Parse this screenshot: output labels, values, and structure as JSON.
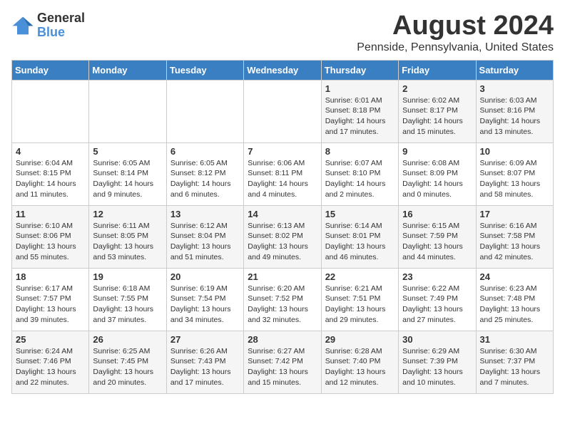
{
  "logo": {
    "general": "General",
    "blue": "Blue"
  },
  "title": "August 2024",
  "location": "Pennside, Pennsylvania, United States",
  "days_of_week": [
    "Sunday",
    "Monday",
    "Tuesday",
    "Wednesday",
    "Thursday",
    "Friday",
    "Saturday"
  ],
  "weeks": [
    [
      {
        "day": "",
        "info": ""
      },
      {
        "day": "",
        "info": ""
      },
      {
        "day": "",
        "info": ""
      },
      {
        "day": "",
        "info": ""
      },
      {
        "day": "1",
        "info": "Sunrise: 6:01 AM\nSunset: 8:18 PM\nDaylight: 14 hours\nand 17 minutes."
      },
      {
        "day": "2",
        "info": "Sunrise: 6:02 AM\nSunset: 8:17 PM\nDaylight: 14 hours\nand 15 minutes."
      },
      {
        "day": "3",
        "info": "Sunrise: 6:03 AM\nSunset: 8:16 PM\nDaylight: 14 hours\nand 13 minutes."
      }
    ],
    [
      {
        "day": "4",
        "info": "Sunrise: 6:04 AM\nSunset: 8:15 PM\nDaylight: 14 hours\nand 11 minutes."
      },
      {
        "day": "5",
        "info": "Sunrise: 6:05 AM\nSunset: 8:14 PM\nDaylight: 14 hours\nand 9 minutes."
      },
      {
        "day": "6",
        "info": "Sunrise: 6:05 AM\nSunset: 8:12 PM\nDaylight: 14 hours\nand 6 minutes."
      },
      {
        "day": "7",
        "info": "Sunrise: 6:06 AM\nSunset: 8:11 PM\nDaylight: 14 hours\nand 4 minutes."
      },
      {
        "day": "8",
        "info": "Sunrise: 6:07 AM\nSunset: 8:10 PM\nDaylight: 14 hours\nand 2 minutes."
      },
      {
        "day": "9",
        "info": "Sunrise: 6:08 AM\nSunset: 8:09 PM\nDaylight: 14 hours\nand 0 minutes."
      },
      {
        "day": "10",
        "info": "Sunrise: 6:09 AM\nSunset: 8:07 PM\nDaylight: 13 hours\nand 58 minutes."
      }
    ],
    [
      {
        "day": "11",
        "info": "Sunrise: 6:10 AM\nSunset: 8:06 PM\nDaylight: 13 hours\nand 55 minutes."
      },
      {
        "day": "12",
        "info": "Sunrise: 6:11 AM\nSunset: 8:05 PM\nDaylight: 13 hours\nand 53 minutes."
      },
      {
        "day": "13",
        "info": "Sunrise: 6:12 AM\nSunset: 8:04 PM\nDaylight: 13 hours\nand 51 minutes."
      },
      {
        "day": "14",
        "info": "Sunrise: 6:13 AM\nSunset: 8:02 PM\nDaylight: 13 hours\nand 49 minutes."
      },
      {
        "day": "15",
        "info": "Sunrise: 6:14 AM\nSunset: 8:01 PM\nDaylight: 13 hours\nand 46 minutes."
      },
      {
        "day": "16",
        "info": "Sunrise: 6:15 AM\nSunset: 7:59 PM\nDaylight: 13 hours\nand 44 minutes."
      },
      {
        "day": "17",
        "info": "Sunrise: 6:16 AM\nSunset: 7:58 PM\nDaylight: 13 hours\nand 42 minutes."
      }
    ],
    [
      {
        "day": "18",
        "info": "Sunrise: 6:17 AM\nSunset: 7:57 PM\nDaylight: 13 hours\nand 39 minutes."
      },
      {
        "day": "19",
        "info": "Sunrise: 6:18 AM\nSunset: 7:55 PM\nDaylight: 13 hours\nand 37 minutes."
      },
      {
        "day": "20",
        "info": "Sunrise: 6:19 AM\nSunset: 7:54 PM\nDaylight: 13 hours\nand 34 minutes."
      },
      {
        "day": "21",
        "info": "Sunrise: 6:20 AM\nSunset: 7:52 PM\nDaylight: 13 hours\nand 32 minutes."
      },
      {
        "day": "22",
        "info": "Sunrise: 6:21 AM\nSunset: 7:51 PM\nDaylight: 13 hours\nand 29 minutes."
      },
      {
        "day": "23",
        "info": "Sunrise: 6:22 AM\nSunset: 7:49 PM\nDaylight: 13 hours\nand 27 minutes."
      },
      {
        "day": "24",
        "info": "Sunrise: 6:23 AM\nSunset: 7:48 PM\nDaylight: 13 hours\nand 25 minutes."
      }
    ],
    [
      {
        "day": "25",
        "info": "Sunrise: 6:24 AM\nSunset: 7:46 PM\nDaylight: 13 hours\nand 22 minutes."
      },
      {
        "day": "26",
        "info": "Sunrise: 6:25 AM\nSunset: 7:45 PM\nDaylight: 13 hours\nand 20 minutes."
      },
      {
        "day": "27",
        "info": "Sunrise: 6:26 AM\nSunset: 7:43 PM\nDaylight: 13 hours\nand 17 minutes."
      },
      {
        "day": "28",
        "info": "Sunrise: 6:27 AM\nSunset: 7:42 PM\nDaylight: 13 hours\nand 15 minutes."
      },
      {
        "day": "29",
        "info": "Sunrise: 6:28 AM\nSunset: 7:40 PM\nDaylight: 13 hours\nand 12 minutes."
      },
      {
        "day": "30",
        "info": "Sunrise: 6:29 AM\nSunset: 7:39 PM\nDaylight: 13 hours\nand 10 minutes."
      },
      {
        "day": "31",
        "info": "Sunrise: 6:30 AM\nSunset: 7:37 PM\nDaylight: 13 hours\nand 7 minutes."
      }
    ]
  ]
}
